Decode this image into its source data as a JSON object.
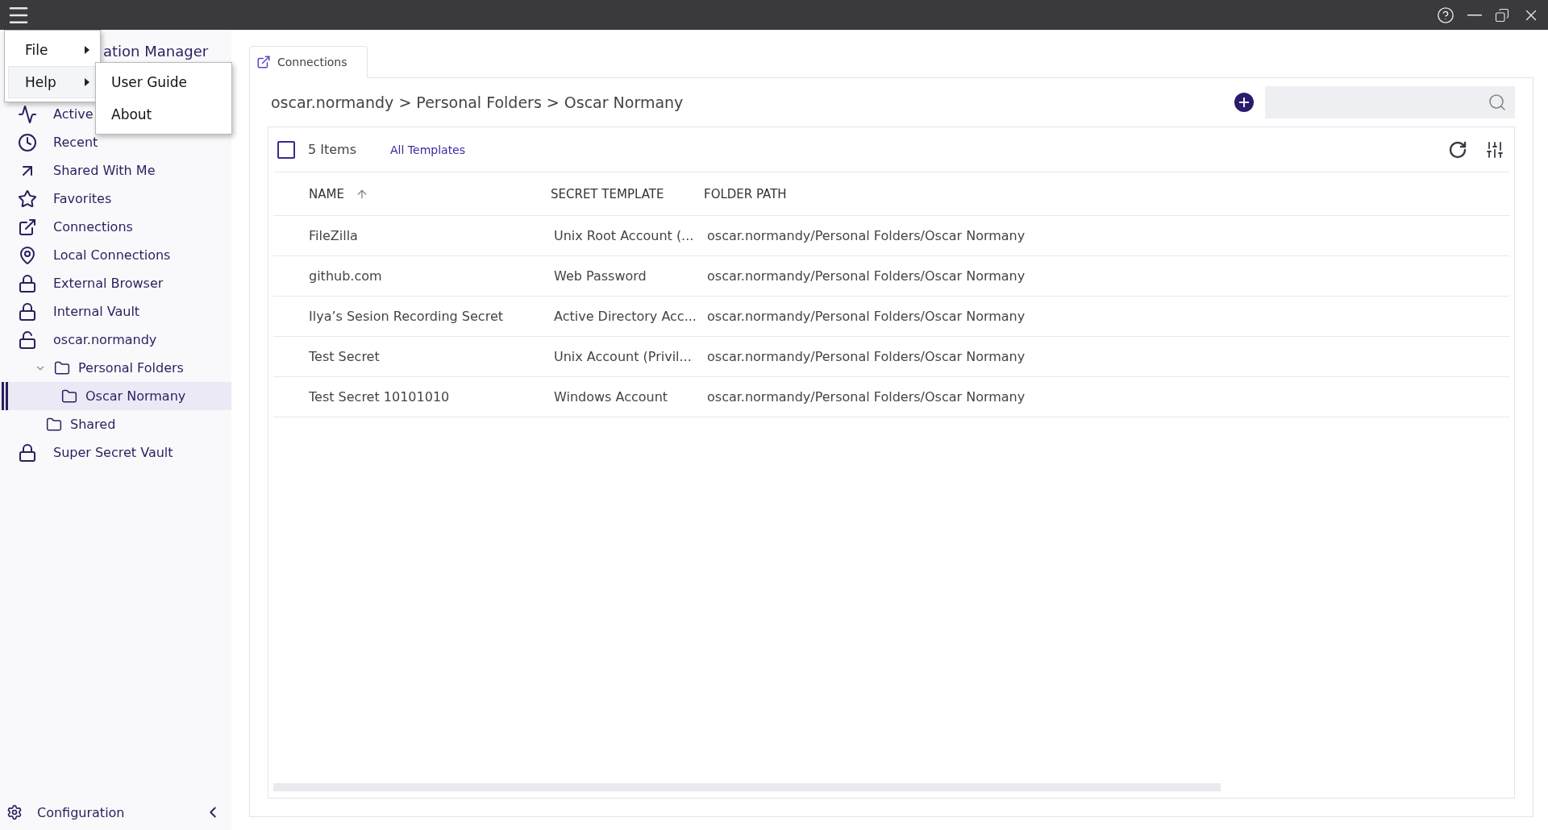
{
  "menu": {
    "items": [
      {
        "label": "File",
        "open": false
      },
      {
        "label": "Help",
        "open": true,
        "children": [
          {
            "label": "User Guide"
          },
          {
            "label": "About"
          }
        ]
      }
    ]
  },
  "sidebar": {
    "title": "ation Manager",
    "items": [
      {
        "label": "Active",
        "kind": "nav",
        "selected": false
      },
      {
        "label": "Recent",
        "kind": "nav",
        "selected": false
      },
      {
        "label": "Shared With Me",
        "kind": "nav",
        "selected": false
      },
      {
        "label": "Favorites",
        "kind": "nav",
        "selected": false
      },
      {
        "label": "Connections",
        "kind": "nav",
        "selected": false
      },
      {
        "label": "Local Connections",
        "kind": "nav",
        "selected": false
      },
      {
        "label": "External Browser",
        "kind": "vault",
        "locked": true,
        "selected": false
      },
      {
        "label": "Internal Vault",
        "kind": "vault",
        "locked": true,
        "selected": false
      },
      {
        "label": "oscar.normandy",
        "kind": "vault",
        "locked": false,
        "selected": false,
        "children": [
          {
            "label": "Personal Folders",
            "kind": "folder",
            "expanded": true,
            "selected": false,
            "children": [
              {
                "label": "Oscar Normany",
                "kind": "folder",
                "selected": true
              }
            ]
          },
          {
            "label": "Shared",
            "kind": "folder",
            "selected": false
          }
        ]
      },
      {
        "label": "Super Secret Vault",
        "kind": "vault",
        "locked": true,
        "selected": false
      }
    ],
    "footer": "Configuration"
  },
  "tabs": [
    {
      "label": "Connections",
      "selected": true
    }
  ],
  "breadcrumb": [
    "oscar.normandy",
    "Personal Folders",
    "Oscar Normany"
  ],
  "breadcrumb_separator": ">",
  "toolbar": {
    "select_all_checked": false,
    "count": "5",
    "count_label": "Items",
    "filter": "All Templates"
  },
  "table": {
    "columns": [
      {
        "label": "NAME",
        "sorted": true
      },
      {
        "label": "SECRET TEMPLATE",
        "sorted": false
      },
      {
        "label": "FOLDER PATH",
        "sorted": false
      }
    ],
    "rows": [
      [
        "FileZilla",
        "Unix Root Account (...",
        "oscar.normandy/Personal Folders/Oscar Normany"
      ],
      [
        "github.com",
        "Web Password",
        "oscar.normandy/Personal Folders/Oscar Normany"
      ],
      [
        "Ilya’s Sesion Recording Secret",
        "Active Directory Acc...",
        "oscar.normandy/Personal Folders/Oscar Normany"
      ],
      [
        "Test Secret",
        "Unix Account (Privil...",
        "oscar.normandy/Personal Folders/Oscar Normany"
      ],
      [
        "Test Secret 10101010",
        "Windows Account",
        "oscar.normandy/Personal Folders/Oscar Normany"
      ]
    ]
  }
}
